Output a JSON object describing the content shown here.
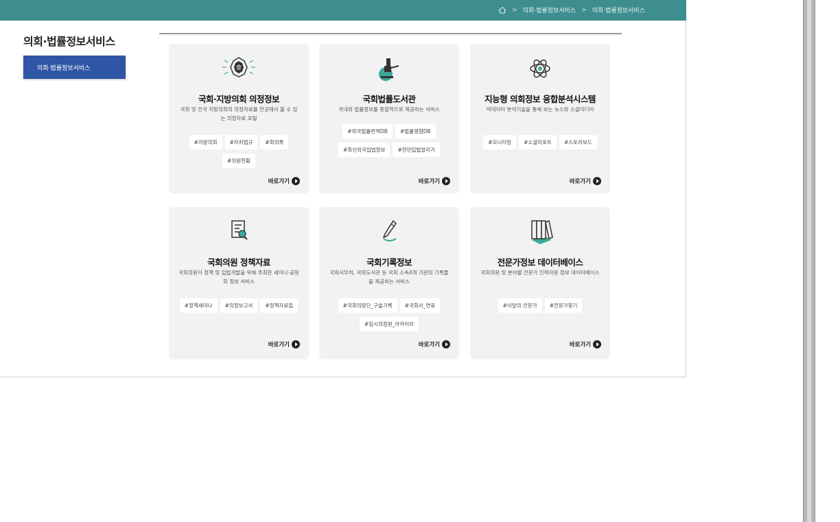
{
  "header": {
    "breadcrumb": [
      "의회·법률정보서비스",
      "의회·법률정보서비스"
    ],
    "breadcrumb_sep": ">"
  },
  "sidebar": {
    "title": "의회·법률정보서비스",
    "active_item": "의회·법률정보서비스"
  },
  "go_label": "바로가기",
  "cards": [
    {
      "title": "국회·지방의회 의정정보",
      "desc": "국회 및 전국 지방의회의 의정자료를 한곳에서 볼 수 있는 의정자료 포털",
      "tags": [
        "#지방의회",
        "#자치법규",
        "#회의록",
        "#의원현황"
      ],
      "icon": "assembly-emblem-icon"
    },
    {
      "title": "국회법률도서관",
      "desc": "국내외 법률정보를 종합적으로 제공하는 서비스",
      "tags": [
        "#외국법률번역DB",
        "#법률쟁점DB",
        "#최신외국입법정보",
        "#현안입법알리기"
      ],
      "icon": "gavel-icon"
    },
    {
      "title": "지능형 의회정보 융합분석시스템",
      "desc": "빅데이터 분석기술을 통해 보는 뉴스와 소셜미디어",
      "tags": [
        "#모니터링",
        "#소셜리포트",
        "#스토리보드"
      ],
      "icon": "atom-icon"
    },
    {
      "title": "국회의원 정책자료",
      "desc": "국회의원이 정책 및 입법개발을 위해 주최한 세미나·공청회 정보 서비스",
      "tags": [
        "#정책세미나",
        "#의정보고서",
        "#정책자료집"
      ],
      "icon": "document-search-icon"
    },
    {
      "title": "국회기록정보",
      "desc": "국회사무처, 국회도서관 등 국회 소속4개 기관의 기록물을 제공하는 서비스",
      "tags": [
        "#국회의장단_구술기록",
        "#국회사_연표",
        "#임시의정원_아카이브"
      ],
      "icon": "pen-icon"
    },
    {
      "title": "전문가정보 데이터베이스",
      "desc": "국회의원 및 분야별 전문가 인력자원 정보 데이터베이스",
      "tags": [
        "#이달의 전문가",
        "#전문가찾기"
      ],
      "icon": "books-icon"
    }
  ],
  "colors": {
    "topbar": "#3e8e90",
    "accent_button": "#2f56a6",
    "card_bg": "#f2f2f2",
    "icon_teal": "#3aa89a"
  }
}
